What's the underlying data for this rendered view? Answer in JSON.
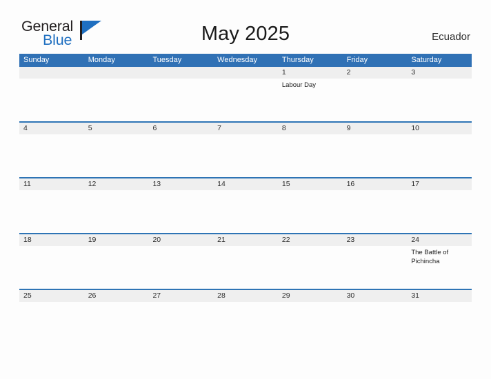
{
  "brand": {
    "word_one": "General",
    "word_two": "Blue",
    "accent_color": "#1f6fc0",
    "flag_icon": "flag-triangle-icon"
  },
  "header": {
    "title": "May 2025",
    "country": "Ecuador"
  },
  "theme": {
    "header_blue": "#3071b5",
    "row_rule_blue": "#2e74b5",
    "date_band_gray": "#efefef",
    "page_background": "#fdfdfd"
  },
  "calendar": {
    "weekdays": [
      "Sunday",
      "Monday",
      "Tuesday",
      "Wednesday",
      "Thursday",
      "Friday",
      "Saturday"
    ],
    "weeks": [
      [
        {
          "date": "",
          "events": []
        },
        {
          "date": "",
          "events": []
        },
        {
          "date": "",
          "events": []
        },
        {
          "date": "",
          "events": []
        },
        {
          "date": "1",
          "events": [
            "Labour Day"
          ]
        },
        {
          "date": "2",
          "events": []
        },
        {
          "date": "3",
          "events": []
        }
      ],
      [
        {
          "date": "4",
          "events": []
        },
        {
          "date": "5",
          "events": []
        },
        {
          "date": "6",
          "events": []
        },
        {
          "date": "7",
          "events": []
        },
        {
          "date": "8",
          "events": []
        },
        {
          "date": "9",
          "events": []
        },
        {
          "date": "10",
          "events": []
        }
      ],
      [
        {
          "date": "11",
          "events": []
        },
        {
          "date": "12",
          "events": []
        },
        {
          "date": "13",
          "events": []
        },
        {
          "date": "14",
          "events": []
        },
        {
          "date": "15",
          "events": []
        },
        {
          "date": "16",
          "events": []
        },
        {
          "date": "17",
          "events": []
        }
      ],
      [
        {
          "date": "18",
          "events": []
        },
        {
          "date": "19",
          "events": []
        },
        {
          "date": "20",
          "events": []
        },
        {
          "date": "21",
          "events": []
        },
        {
          "date": "22",
          "events": []
        },
        {
          "date": "23",
          "events": []
        },
        {
          "date": "24",
          "events": [
            "The Battle of Pichincha"
          ]
        }
      ],
      [
        {
          "date": "25",
          "events": []
        },
        {
          "date": "26",
          "events": []
        },
        {
          "date": "27",
          "events": []
        },
        {
          "date": "28",
          "events": []
        },
        {
          "date": "29",
          "events": []
        },
        {
          "date": "30",
          "events": []
        },
        {
          "date": "31",
          "events": []
        }
      ]
    ]
  }
}
